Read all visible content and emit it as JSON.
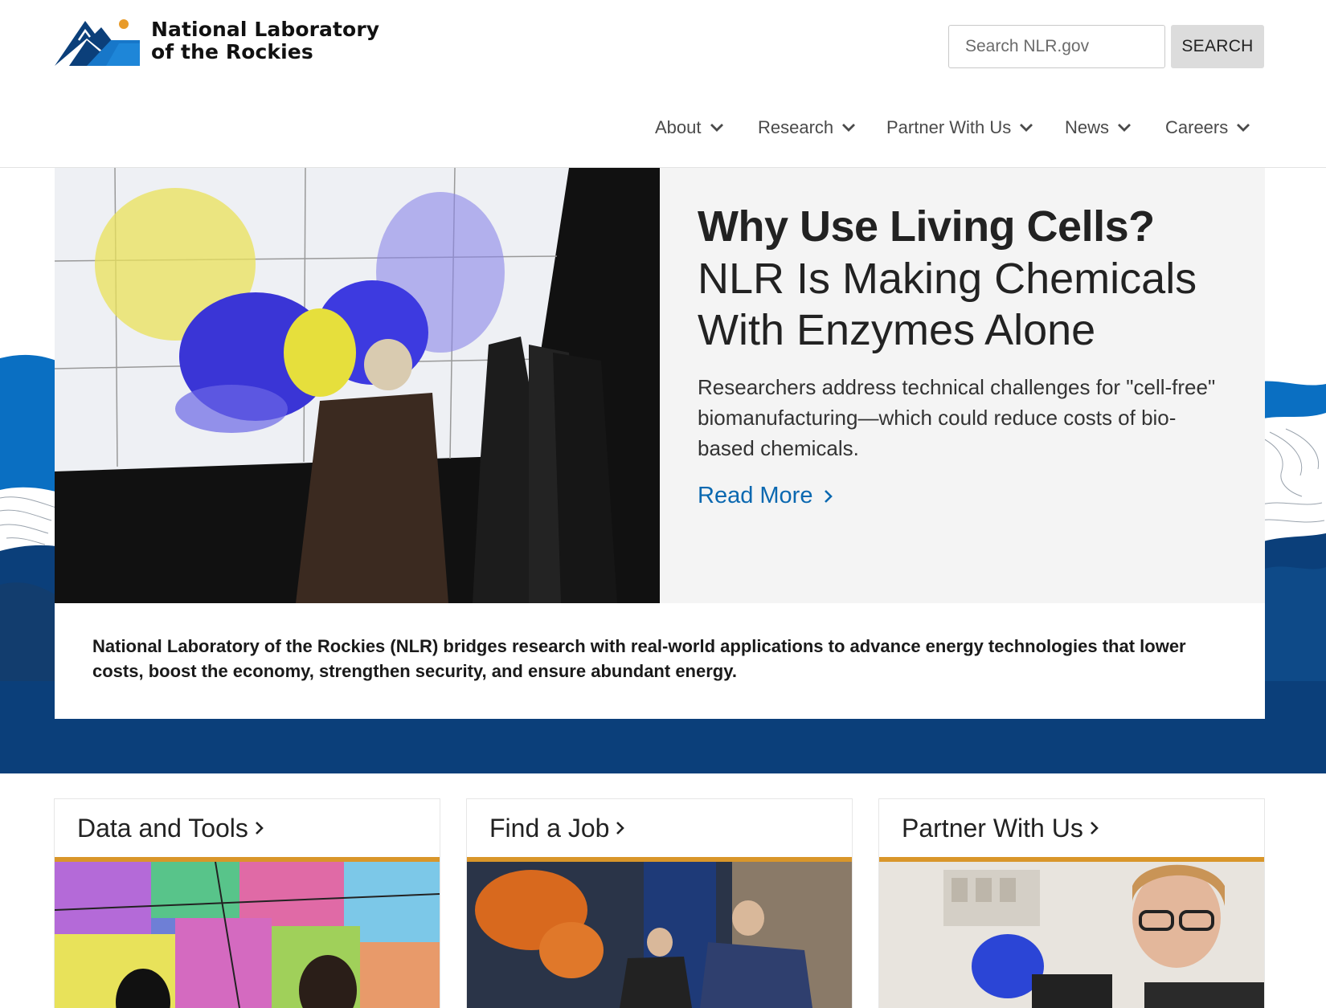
{
  "header": {
    "logo_line1": "National Laboratory",
    "logo_line2": "of the Rockies",
    "search_placeholder": "Search NLR.gov",
    "search_button": "SEARCH"
  },
  "nav": [
    {
      "label": "About"
    },
    {
      "label": "Research"
    },
    {
      "label": "Partner With Us"
    },
    {
      "label": "News"
    },
    {
      "label": "Careers"
    }
  ],
  "hero": {
    "title_bold": "Why Use Living Cells?",
    "title_rest": "NLR Is Making Chemicals With Enzymes Alone",
    "description": "Researchers address technical challenges for \"cell-free\" biomanufacturing—which could reduce costs of bio-based chemicals.",
    "link": "Read More"
  },
  "mission": "National Laboratory of the Rockies (NLR) bridges research with real-world applications to advance energy technologies that lower costs, boost the economy, strengthen security, and ensure abundant energy.",
  "cards": [
    {
      "title": "Data and Tools"
    },
    {
      "title": "Find a Job"
    },
    {
      "title": "Partner With Us"
    }
  ],
  "colors": {
    "brand_dark_blue": "#0b3f7a",
    "brand_blue": "#0a6fc2",
    "accent_gold": "#d9962a",
    "link_blue": "#0a68b0"
  }
}
